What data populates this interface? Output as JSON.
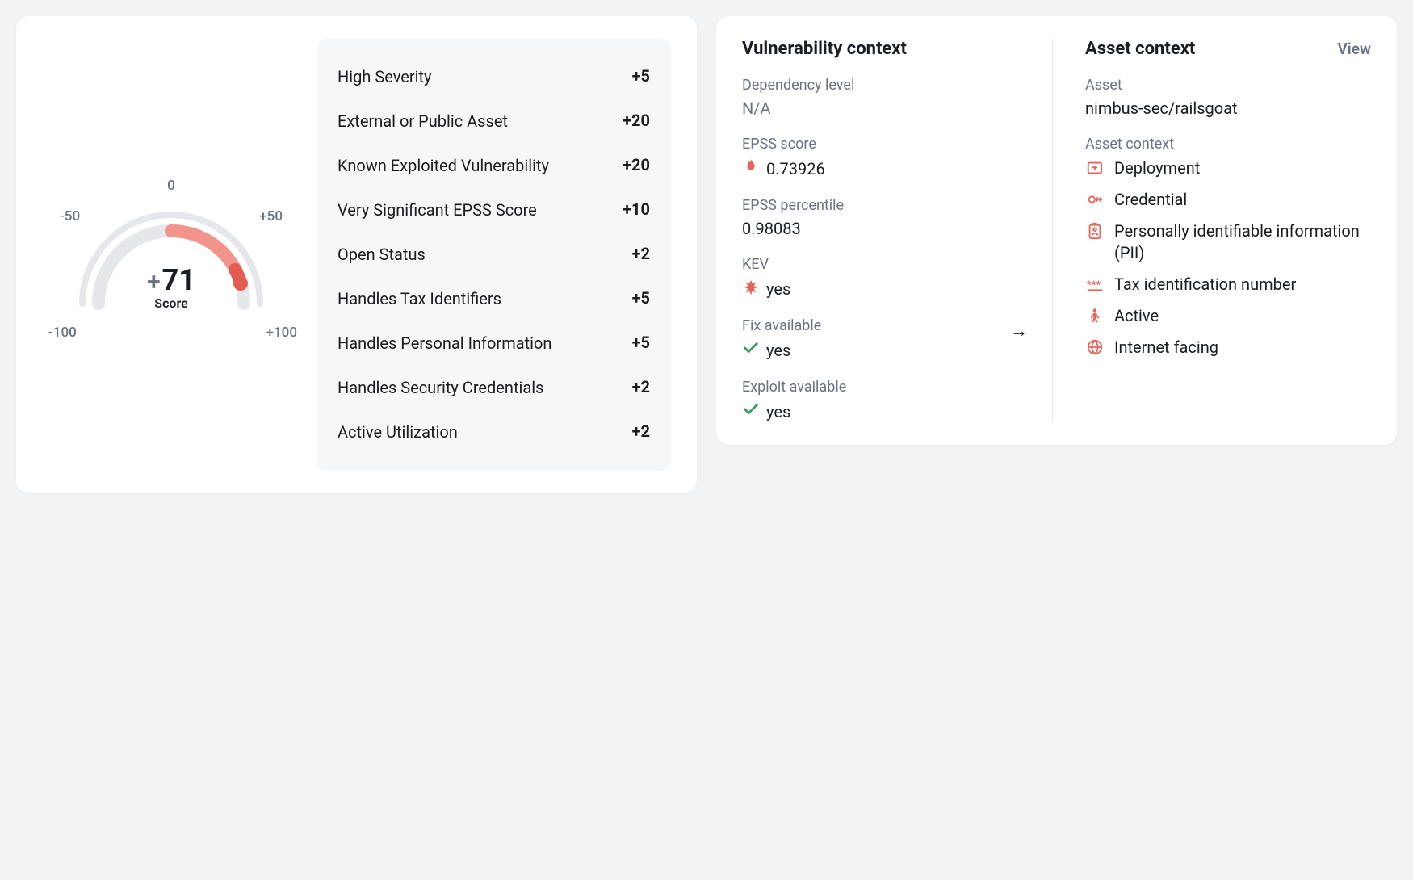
{
  "gauge": {
    "score": "71",
    "score_sign": "+",
    "score_label": "Score",
    "ticks": {
      "m100": "-100",
      "m50": "-50",
      "zero": "0",
      "p50": "+50",
      "p100": "+100"
    }
  },
  "factors": [
    {
      "label": "High Severity",
      "value": "+5"
    },
    {
      "label": "External or Public Asset",
      "value": "+20"
    },
    {
      "label": "Known Exploited Vulnerability",
      "value": "+20"
    },
    {
      "label": "Very Significant EPSS Score",
      "value": "+10"
    },
    {
      "label": "Open Status",
      "value": "+2"
    },
    {
      "label": "Handles Tax Identifiers",
      "value": "+5"
    },
    {
      "label": "Handles Personal Information",
      "value": "+5"
    },
    {
      "label": "Handles Security Credentials",
      "value": "+2"
    },
    {
      "label": "Active Utilization",
      "value": "+2"
    }
  ],
  "vuln_context": {
    "heading": "Vulnerability context",
    "dependency_level": {
      "label": "Dependency level",
      "value": "N/A"
    },
    "epss_score": {
      "label": "EPSS score",
      "value": "0.73926"
    },
    "epss_percentile": {
      "label": "EPSS percentile",
      "value": "0.98083"
    },
    "kev": {
      "label": "KEV",
      "value": "yes"
    },
    "fix_available": {
      "label": "Fix available",
      "value": "yes"
    },
    "exploit_available": {
      "label": "Exploit available",
      "value": "yes"
    }
  },
  "asset_context": {
    "heading": "Asset context",
    "view_label": "View",
    "asset_label": "Asset",
    "asset_value": "nimbus-sec/railsgoat",
    "list_label": "Asset context",
    "items": [
      {
        "icon": "deployment",
        "label": "Deployment"
      },
      {
        "icon": "key",
        "label": "Credential"
      },
      {
        "icon": "id-badge",
        "label": "Personally identifiable information (PII)"
      },
      {
        "icon": "asterisks",
        "label": "Tax identification number"
      },
      {
        "icon": "person",
        "label": "Active"
      },
      {
        "icon": "globe",
        "label": "Internet facing"
      }
    ]
  }
}
